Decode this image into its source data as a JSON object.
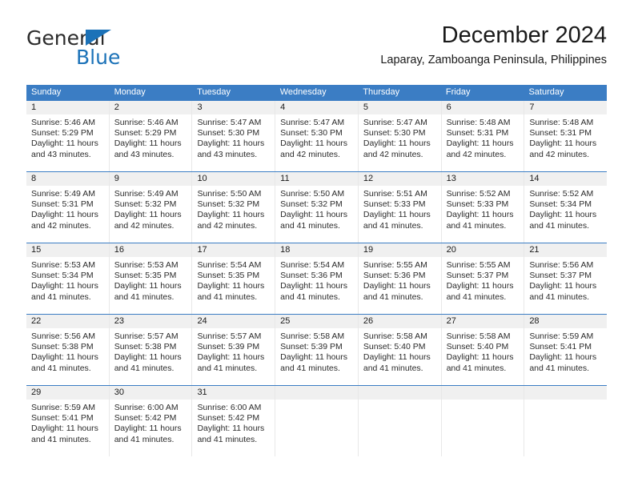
{
  "brand": {
    "word1": "General",
    "word2": "Blue",
    "accent_color": "#1b72b8",
    "triangle_icon": "brand-triangle-icon"
  },
  "header": {
    "title": "December 2024",
    "subtitle": "Laparay, Zamboanga Peninsula, Philippines"
  },
  "calendar": {
    "header_bg": "#3b7dc4",
    "daynum_bg": "#f0f0f0",
    "weekdays": [
      "Sunday",
      "Monday",
      "Tuesday",
      "Wednesday",
      "Thursday",
      "Friday",
      "Saturday"
    ],
    "weeks": [
      [
        {
          "day": "1",
          "sunrise": "Sunrise: 5:46 AM",
          "sunset": "Sunset: 5:29 PM",
          "daylight1": "Daylight: 11 hours",
          "daylight2": "and 43 minutes."
        },
        {
          "day": "2",
          "sunrise": "Sunrise: 5:46 AM",
          "sunset": "Sunset: 5:29 PM",
          "daylight1": "Daylight: 11 hours",
          "daylight2": "and 43 minutes."
        },
        {
          "day": "3",
          "sunrise": "Sunrise: 5:47 AM",
          "sunset": "Sunset: 5:30 PM",
          "daylight1": "Daylight: 11 hours",
          "daylight2": "and 43 minutes."
        },
        {
          "day": "4",
          "sunrise": "Sunrise: 5:47 AM",
          "sunset": "Sunset: 5:30 PM",
          "daylight1": "Daylight: 11 hours",
          "daylight2": "and 42 minutes."
        },
        {
          "day": "5",
          "sunrise": "Sunrise: 5:47 AM",
          "sunset": "Sunset: 5:30 PM",
          "daylight1": "Daylight: 11 hours",
          "daylight2": "and 42 minutes."
        },
        {
          "day": "6",
          "sunrise": "Sunrise: 5:48 AM",
          "sunset": "Sunset: 5:31 PM",
          "daylight1": "Daylight: 11 hours",
          "daylight2": "and 42 minutes."
        },
        {
          "day": "7",
          "sunrise": "Sunrise: 5:48 AM",
          "sunset": "Sunset: 5:31 PM",
          "daylight1": "Daylight: 11 hours",
          "daylight2": "and 42 minutes."
        }
      ],
      [
        {
          "day": "8",
          "sunrise": "Sunrise: 5:49 AM",
          "sunset": "Sunset: 5:31 PM",
          "daylight1": "Daylight: 11 hours",
          "daylight2": "and 42 minutes."
        },
        {
          "day": "9",
          "sunrise": "Sunrise: 5:49 AM",
          "sunset": "Sunset: 5:32 PM",
          "daylight1": "Daylight: 11 hours",
          "daylight2": "and 42 minutes."
        },
        {
          "day": "10",
          "sunrise": "Sunrise: 5:50 AM",
          "sunset": "Sunset: 5:32 PM",
          "daylight1": "Daylight: 11 hours",
          "daylight2": "and 42 minutes."
        },
        {
          "day": "11",
          "sunrise": "Sunrise: 5:50 AM",
          "sunset": "Sunset: 5:32 PM",
          "daylight1": "Daylight: 11 hours",
          "daylight2": "and 41 minutes."
        },
        {
          "day": "12",
          "sunrise": "Sunrise: 5:51 AM",
          "sunset": "Sunset: 5:33 PM",
          "daylight1": "Daylight: 11 hours",
          "daylight2": "and 41 minutes."
        },
        {
          "day": "13",
          "sunrise": "Sunrise: 5:52 AM",
          "sunset": "Sunset: 5:33 PM",
          "daylight1": "Daylight: 11 hours",
          "daylight2": "and 41 minutes."
        },
        {
          "day": "14",
          "sunrise": "Sunrise: 5:52 AM",
          "sunset": "Sunset: 5:34 PM",
          "daylight1": "Daylight: 11 hours",
          "daylight2": "and 41 minutes."
        }
      ],
      [
        {
          "day": "15",
          "sunrise": "Sunrise: 5:53 AM",
          "sunset": "Sunset: 5:34 PM",
          "daylight1": "Daylight: 11 hours",
          "daylight2": "and 41 minutes."
        },
        {
          "day": "16",
          "sunrise": "Sunrise: 5:53 AM",
          "sunset": "Sunset: 5:35 PM",
          "daylight1": "Daylight: 11 hours",
          "daylight2": "and 41 minutes."
        },
        {
          "day": "17",
          "sunrise": "Sunrise: 5:54 AM",
          "sunset": "Sunset: 5:35 PM",
          "daylight1": "Daylight: 11 hours",
          "daylight2": "and 41 minutes."
        },
        {
          "day": "18",
          "sunrise": "Sunrise: 5:54 AM",
          "sunset": "Sunset: 5:36 PM",
          "daylight1": "Daylight: 11 hours",
          "daylight2": "and 41 minutes."
        },
        {
          "day": "19",
          "sunrise": "Sunrise: 5:55 AM",
          "sunset": "Sunset: 5:36 PM",
          "daylight1": "Daylight: 11 hours",
          "daylight2": "and 41 minutes."
        },
        {
          "day": "20",
          "sunrise": "Sunrise: 5:55 AM",
          "sunset": "Sunset: 5:37 PM",
          "daylight1": "Daylight: 11 hours",
          "daylight2": "and 41 minutes."
        },
        {
          "day": "21",
          "sunrise": "Sunrise: 5:56 AM",
          "sunset": "Sunset: 5:37 PM",
          "daylight1": "Daylight: 11 hours",
          "daylight2": "and 41 minutes."
        }
      ],
      [
        {
          "day": "22",
          "sunrise": "Sunrise: 5:56 AM",
          "sunset": "Sunset: 5:38 PM",
          "daylight1": "Daylight: 11 hours",
          "daylight2": "and 41 minutes."
        },
        {
          "day": "23",
          "sunrise": "Sunrise: 5:57 AM",
          "sunset": "Sunset: 5:38 PM",
          "daylight1": "Daylight: 11 hours",
          "daylight2": "and 41 minutes."
        },
        {
          "day": "24",
          "sunrise": "Sunrise: 5:57 AM",
          "sunset": "Sunset: 5:39 PM",
          "daylight1": "Daylight: 11 hours",
          "daylight2": "and 41 minutes."
        },
        {
          "day": "25",
          "sunrise": "Sunrise: 5:58 AM",
          "sunset": "Sunset: 5:39 PM",
          "daylight1": "Daylight: 11 hours",
          "daylight2": "and 41 minutes."
        },
        {
          "day": "26",
          "sunrise": "Sunrise: 5:58 AM",
          "sunset": "Sunset: 5:40 PM",
          "daylight1": "Daylight: 11 hours",
          "daylight2": "and 41 minutes."
        },
        {
          "day": "27",
          "sunrise": "Sunrise: 5:58 AM",
          "sunset": "Sunset: 5:40 PM",
          "daylight1": "Daylight: 11 hours",
          "daylight2": "and 41 minutes."
        },
        {
          "day": "28",
          "sunrise": "Sunrise: 5:59 AM",
          "sunset": "Sunset: 5:41 PM",
          "daylight1": "Daylight: 11 hours",
          "daylight2": "and 41 minutes."
        }
      ],
      [
        {
          "day": "29",
          "sunrise": "Sunrise: 5:59 AM",
          "sunset": "Sunset: 5:41 PM",
          "daylight1": "Daylight: 11 hours",
          "daylight2": "and 41 minutes."
        },
        {
          "day": "30",
          "sunrise": "Sunrise: 6:00 AM",
          "sunset": "Sunset: 5:42 PM",
          "daylight1": "Daylight: 11 hours",
          "daylight2": "and 41 minutes."
        },
        {
          "day": "31",
          "sunrise": "Sunrise: 6:00 AM",
          "sunset": "Sunset: 5:42 PM",
          "daylight1": "Daylight: 11 hours",
          "daylight2": "and 41 minutes."
        },
        {
          "day": "",
          "sunrise": "",
          "sunset": "",
          "daylight1": "",
          "daylight2": ""
        },
        {
          "day": "",
          "sunrise": "",
          "sunset": "",
          "daylight1": "",
          "daylight2": ""
        },
        {
          "day": "",
          "sunrise": "",
          "sunset": "",
          "daylight1": "",
          "daylight2": ""
        },
        {
          "day": "",
          "sunrise": "",
          "sunset": "",
          "daylight1": "",
          "daylight2": ""
        }
      ]
    ]
  }
}
